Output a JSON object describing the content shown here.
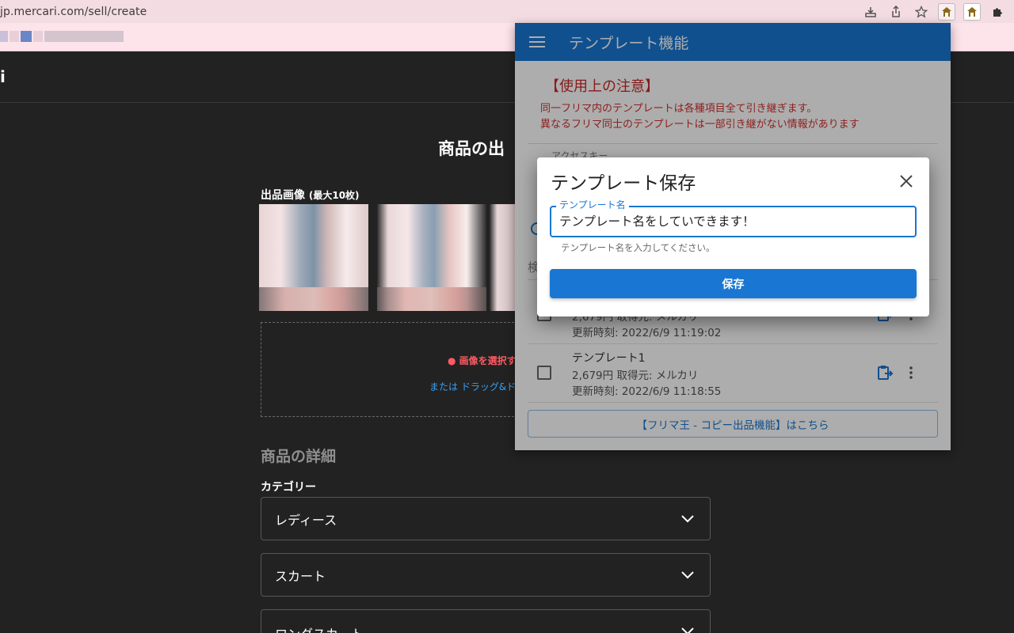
{
  "browser": {
    "url": "jp.mercari.com/sell/create"
  },
  "page": {
    "logo_fragment": "i",
    "title": "商品の出",
    "image_label": "出品画像",
    "image_limit": "(最大10枚)",
    "upload_primary": "画像を選択す",
    "upload_secondary": "または ドラッグ&ド",
    "details_section": "商品の詳細",
    "category_label": "カテゴリー",
    "category_selects": [
      "レディース",
      "スカート",
      "ロングスカート"
    ]
  },
  "panel": {
    "title": "テンプレート機能",
    "notice_title": "【使用上の注意】",
    "notice_lines": [
      "同一フリマ内のテンプレートは各種項目全て引き継ぎます。",
      "異なるフリマ同士のテンプレートは一部引き継がない情報があります"
    ],
    "access_label": "アクセスキー",
    "search_fragment": "検",
    "templates": [
      {
        "name": "",
        "meta": "2,679円 取得元: メルカリ",
        "updated": "更新時刻: 2022/6/9 11:19:02"
      },
      {
        "name": "テンプレート1",
        "meta": "2,679円 取得元: メルカリ",
        "updated": "更新時刻: 2022/6/9 11:18:55"
      }
    ],
    "link_button": "【フリマ王 - コピー出品機能】はこちら"
  },
  "dialog": {
    "title": "テンプレート保存",
    "field_label": "テンプレート名",
    "field_value": "テンプレート名をしていできます！",
    "field_help": "テンプレート名を入力してください。",
    "save_label": "保存"
  },
  "colors": {
    "primary": "#1976d2",
    "warning_text": "#d32f2f",
    "upload_accent": "#ff5a63",
    "link_blue": "#3aa0f0"
  }
}
